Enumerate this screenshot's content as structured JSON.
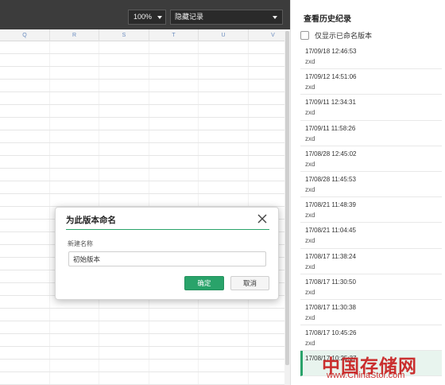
{
  "toolbar": {
    "zoom_value": "100%",
    "history_select_value": "隐藏记录"
  },
  "sheet": {
    "columns": [
      "Q",
      "R",
      "S",
      "T",
      "U",
      "V"
    ]
  },
  "history_panel": {
    "title": "查看历史纪录",
    "named_only_label": "仅显示已命名版本",
    "versions": [
      {
        "timestamp": "17/09/18 12:46:53",
        "author": "zxd"
      },
      {
        "timestamp": "17/09/12 14:51:06",
        "author": "zxd"
      },
      {
        "timestamp": "17/09/11 12:34:31",
        "author": "zxd"
      },
      {
        "timestamp": "17/09/11 11:58:26",
        "author": "zxd"
      },
      {
        "timestamp": "17/08/28 12:45:02",
        "author": "zxd"
      },
      {
        "timestamp": "17/08/28 11:45:53",
        "author": "zxd"
      },
      {
        "timestamp": "17/08/21 11:48:39",
        "author": "zxd"
      },
      {
        "timestamp": "17/08/21 11:04:45",
        "author": "zxd"
      },
      {
        "timestamp": "17/08/17 11:38:24",
        "author": "zxd"
      },
      {
        "timestamp": "17/08/17 11:30:50",
        "author": "zxd"
      },
      {
        "timestamp": "17/08/17 11:30:38",
        "author": "zxd"
      },
      {
        "timestamp": "17/08/17 10:45:26",
        "author": "zxd"
      },
      {
        "timestamp": "17/08/17 10:25:37",
        "author": ""
      }
    ]
  },
  "dialog": {
    "title": "为此版本命名",
    "field_label": "新建名称",
    "input_value": "初始版本",
    "ok_label": "确定",
    "cancel_label": "取消"
  },
  "watermark": {
    "cn_text": "中国存储网",
    "url_text": "www.ChinaStor.com"
  },
  "colors": {
    "accent": "#29a36a",
    "toolbar_bg": "#3c3c3c",
    "watermark": "#c81e1e"
  }
}
